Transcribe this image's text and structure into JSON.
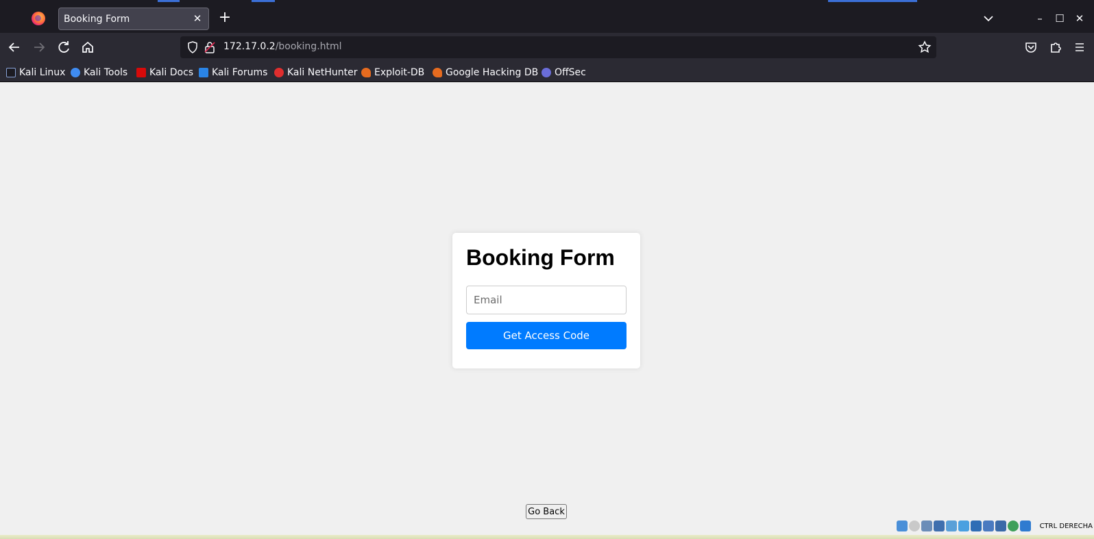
{
  "browser": {
    "tab_title": "Booking Form",
    "tab_close_glyph": "✕",
    "new_tab_glyph": "+",
    "url_host": "172.17.0.2",
    "url_path": "/booking.html",
    "window_controls": {
      "minimize": "–",
      "maximize": "☐",
      "close": "✕"
    }
  },
  "bookmarks": [
    {
      "label": "Kali Linux",
      "color": "#367bf0"
    },
    {
      "label": "Kali Tools",
      "color": "#3f8cf2"
    },
    {
      "label": "Kali Docs",
      "color": "#d70a0a"
    },
    {
      "label": "Kali Forums",
      "color": "#2a84e6"
    },
    {
      "label": "Kali NetHunter",
      "color": "#e02e2e"
    },
    {
      "label": "Exploit-DB",
      "color": "#e66b1f"
    },
    {
      "label": "Google Hacking DB",
      "color": "#e66b1f"
    },
    {
      "label": "OffSec",
      "color": "#6a6dd8"
    }
  ],
  "form": {
    "title": "Booking Form",
    "email_placeholder": "Email",
    "email_value": "",
    "submit_label": "Get Access Code",
    "accent_color": "#007bff"
  },
  "page": {
    "go_back_label": "Go Back"
  },
  "vm_status": {
    "host_key_label": "CTRL DERECHA"
  }
}
